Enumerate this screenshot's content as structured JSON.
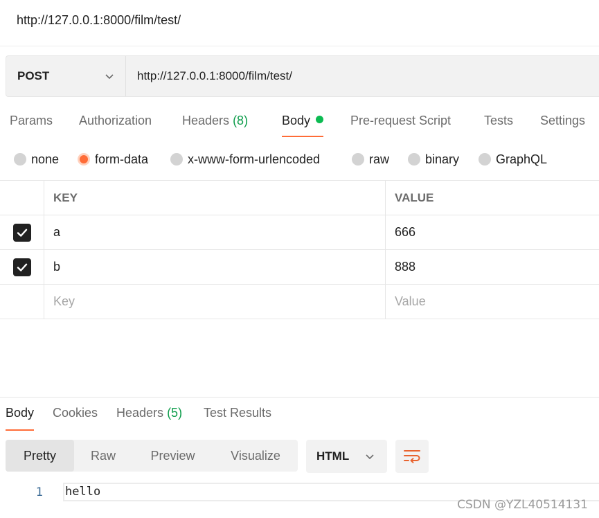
{
  "window": {
    "title": "http://127.0.0.1:8000/film/test/"
  },
  "request": {
    "method": "POST",
    "url": "http://127.0.0.1:8000/film/test/"
  },
  "request_tabs": {
    "params": "Params",
    "authorization": "Authorization",
    "headers_label": "Headers",
    "headers_count": "(8)",
    "body": "Body",
    "pre_request": "Pre-request Script",
    "tests": "Tests",
    "settings": "Settings"
  },
  "body_types": {
    "none": "none",
    "form_data": "form-data",
    "urlencoded": "x-www-form-urlencoded",
    "raw": "raw",
    "binary": "binary",
    "graphql": "GraphQL",
    "selected": "form-data"
  },
  "form_table": {
    "headers": {
      "key": "KEY",
      "value": "VALUE"
    },
    "rows": [
      {
        "key": "a",
        "value": "666",
        "checked": true
      },
      {
        "key": "b",
        "value": "888",
        "checked": true
      }
    ],
    "placeholder": {
      "key": "Key",
      "value": "Value"
    }
  },
  "response_tabs": {
    "body": "Body",
    "cookies": "Cookies",
    "headers_label": "Headers",
    "headers_count": "(5)",
    "test_results": "Test Results"
  },
  "response_view": {
    "pretty": "Pretty",
    "raw": "Raw",
    "preview": "Preview",
    "visualize": "Visualize",
    "format": "HTML"
  },
  "response_body": {
    "lines": [
      {
        "number": "1",
        "text": "hello"
      }
    ]
  },
  "watermark": "CSDN @YZL40514131",
  "colors": {
    "accent": "#ff6c37",
    "success": "#0cbb52",
    "count_green": "#0c9c4a"
  }
}
